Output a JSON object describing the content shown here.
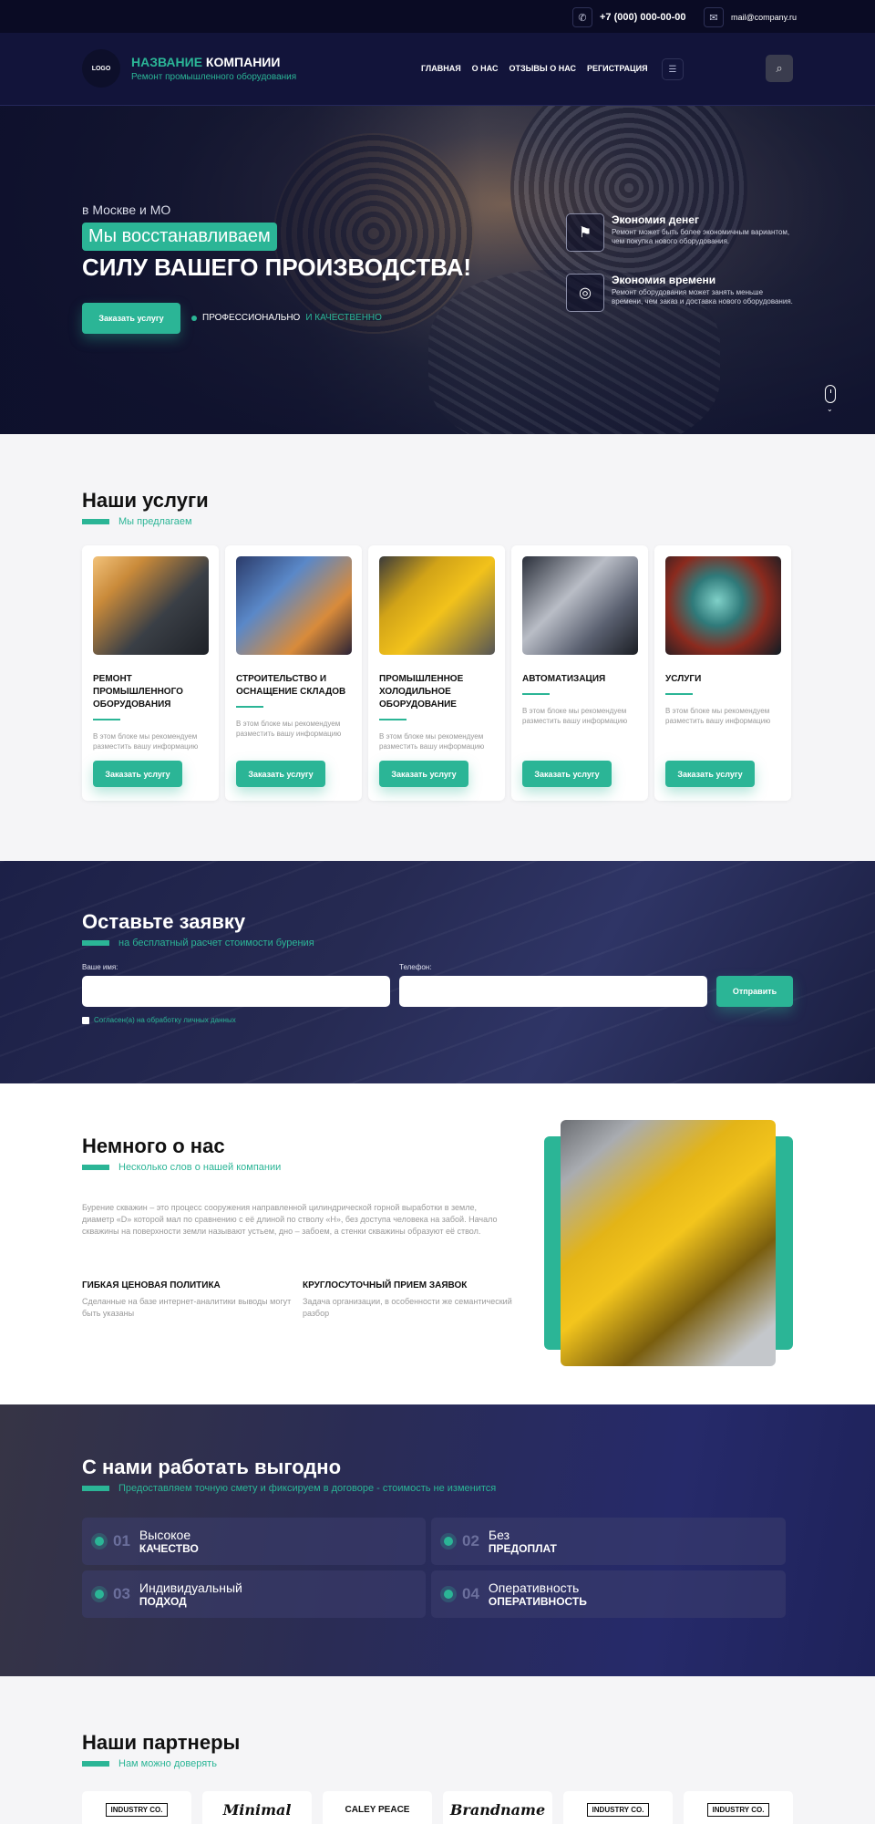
{
  "topbar": {
    "phone": "+7 (000) 000-00-00",
    "email": "mail@company.ru"
  },
  "header": {
    "logo": "LOGO",
    "brand_accent": "НАЗВАНИЕ",
    "brand_rest": "КОМПАНИИ",
    "brand_sub": "Ремонт промышленного оборудования",
    "nav": [
      "ГЛАВНАЯ",
      "О НАС",
      "ОТЗЫВЫ О НАС",
      "РЕГИСТРАЦИЯ"
    ],
    "burger_icon": "☰",
    "search_icon": "⌕"
  },
  "hero": {
    "location": "в Москве и МО",
    "tag": "Мы восстанавливаем",
    "title": "СИЛУ ВАШЕГО ПРОИЗВОДСТВА!",
    "button": "Заказать  услугу",
    "badge_white": "ПРОФЕССИОНАЛЬНО",
    "badge_accent": "И КАЧЕСТВЕННО",
    "features": [
      {
        "icon": "⚑",
        "title": "Экономия денег",
        "text": "Ремонт может быть более экономичным вариантом, чем покупка нового оборудования."
      },
      {
        "icon": "◎",
        "title": "Экономия времени",
        "text": "Ремонт оборудования может занять меньше времени, чем заказ и доставка нового оборудования."
      }
    ],
    "scroll_arrow": "⌄"
  },
  "services": {
    "title": "Наши услуги",
    "subtitle": "Мы предлагаем",
    "cards": [
      {
        "title": "РЕМОНТ ПРОМЫШЛЕННОГО ОБОРУДОВАНИЯ",
        "text": "В этом блоке мы рекомендуем разместить вашу информацию",
        "button": "Заказать  услугу"
      },
      {
        "title": "СТРОИТЕЛЬСТВО И ОСНАЩЕНИЕ СКЛАДОВ",
        "text": "В этом блоке мы рекомендуем разместить вашу информацию",
        "button": "Заказать  услугу"
      },
      {
        "title": "ПРОМЫШЛЕННОЕ ХОЛОДИЛЬНОЕ ОБОРУДОВАНИЕ",
        "text": "В этом блоке мы рекомендуем разместить вашу информацию",
        "button": "Заказать  услугу"
      },
      {
        "title": "АВТОМАТИЗАЦИЯ",
        "text": "В этом блоке мы рекомендуем разместить вашу информацию",
        "button": "Заказать  услугу"
      },
      {
        "title": "УСЛУГИ",
        "text": "В этом блоке мы рекомендуем разместить вашу информацию",
        "button": "Заказать  услугу"
      }
    ]
  },
  "request": {
    "title": "Оставьте заявку",
    "subtitle": "на бесплатный расчет стоимости бурения",
    "name_label": "Ваше имя:",
    "phone_label": "Телефон:",
    "name_value": "",
    "phone_value": "",
    "submit": "Отправить",
    "agree": "Согласен(а) на обработку личных данных"
  },
  "about": {
    "title": "Немного о нас",
    "subtitle": "Несколько слов о нашей компании",
    "text": "Бурение скважин – это процесс сооружения направленной цилиндрической горной выработки в земле, диаметр «D» которой мал по сравнению с её длиной по стволу «H», без доступа человека на забой. Начало скважины на поверхности земли называют устьем, дно – забоем, а стенки скважины образуют её ствол.",
    "cols": [
      {
        "title": "ГИБКАЯ ЦЕНОВАЯ ПОЛИТИКА",
        "text": "Сделанные на базе интернет-аналитики выводы могут быть указаны"
      },
      {
        "title": "КРУГЛОСУТОЧНЫЙ ПРИЕМ ЗАЯВОК",
        "text": "Задача организации, в особенности же семантический разбор"
      }
    ]
  },
  "benefits": {
    "title": "С нами работать выгодно",
    "subtitle": "Предоставляем точную смету и фиксируем в договоре - стоимость не изменится",
    "items": [
      {
        "num": "01",
        "line1": "Высокое",
        "line2": "КАЧЕСТВО"
      },
      {
        "num": "02",
        "line1": "Без",
        "line2": "ПРЕДОПЛАТ"
      },
      {
        "num": "03",
        "line1": "Индивидуальный",
        "line2": "ПОДХОД"
      },
      {
        "num": "04",
        "line1": "Оперативность",
        "line2": "ОПЕРАТИВНОСТЬ"
      }
    ]
  },
  "partners": {
    "title": "Наши партнеры",
    "subtitle": "Нам можно доверять",
    "logos": [
      "INDUSTRY CO.",
      "Minimal",
      "CALEY PEACE",
      "Brandname",
      "INDUSTRY CO.",
      "INDUSTRY CO."
    ]
  },
  "colors": {
    "accent": "#2bb596",
    "dark": "#12143a"
  }
}
